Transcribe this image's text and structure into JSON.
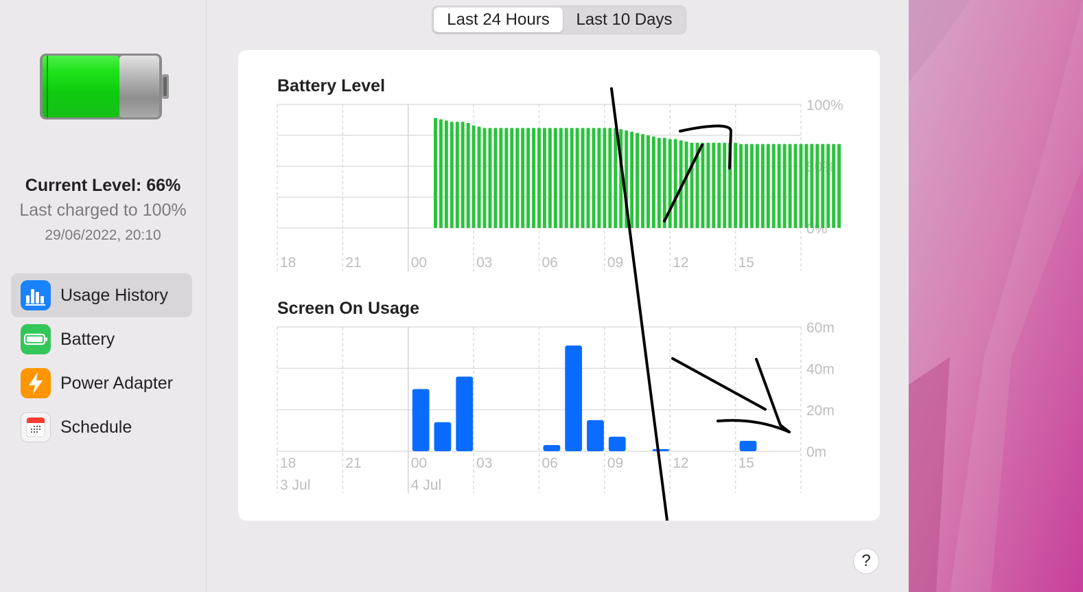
{
  "sidebar": {
    "current_level": "Current Level: 66%",
    "battery_fraction": 0.66,
    "last_charged": "Last charged to 100%",
    "charged_date": "29/06/2022, 20:10",
    "items": [
      {
        "label": "Usage History",
        "icon": "bar-chart-icon",
        "color": "#1a82fb",
        "active": true
      },
      {
        "label": "Battery",
        "icon": "battery-icon",
        "color": "#33c759",
        "active": false
      },
      {
        "label": "Power Adapter",
        "icon": "lightning-bolt-icon",
        "color": "#ff9500",
        "active": false
      },
      {
        "label": "Schedule",
        "icon": "calendar-icon",
        "color": "#ff3b30",
        "active": false
      }
    ]
  },
  "segmented": {
    "options": [
      "Last 24 Hours",
      "Last 10 Days"
    ],
    "selected": 0
  },
  "help_label": "?",
  "colors": {
    "battery_green": "#2ac33c",
    "usage_blue": "#0a6cff"
  },
  "chart_data": [
    {
      "type": "bar",
      "title": "Battery Level",
      "y_ticks": [
        "100%",
        "50%",
        "0%"
      ],
      "ylim": [
        0,
        100
      ],
      "x_ticks": [
        "18",
        "21",
        "00",
        "03",
        "06",
        "09",
        "12",
        "15"
      ],
      "x_hours": [
        18,
        21,
        24,
        27,
        30,
        33,
        36,
        39
      ],
      "bar_start_hour": 25.25,
      "bar_step_hours": 0.25,
      "values": [
        89,
        88,
        87,
        86,
        86,
        86,
        85,
        83,
        82,
        81,
        81,
        81,
        81,
        81,
        81,
        81,
        81,
        81,
        81,
        81,
        81,
        81,
        81,
        81,
        81,
        81,
        81,
        81,
        81,
        81,
        81,
        81,
        81,
        81,
        80,
        79,
        78,
        77,
        76,
        75,
        74,
        73,
        73,
        72,
        72,
        71,
        70,
        69,
        69,
        69,
        69,
        69,
        69,
        69,
        69,
        69,
        68,
        68,
        68,
        68,
        68,
        68,
        68,
        68,
        68,
        68,
        68,
        68,
        68,
        68,
        68,
        68,
        68,
        68,
        68
      ],
      "color": "#2ac33c"
    },
    {
      "type": "bar",
      "title": "Screen On Usage",
      "y_ticks": [
        "60m",
        "40m",
        "20m",
        "0m"
      ],
      "ylim": [
        0,
        60
      ],
      "x_ticks": [
        "18",
        "21",
        "00",
        "03",
        "06",
        "09",
        "12",
        "15"
      ],
      "date_labels": [
        {
          "label": "3 Jul",
          "hour": 18
        },
        {
          "label": "4 Jul",
          "hour": 24
        }
      ],
      "bars": [
        {
          "hour": 25,
          "value": 30
        },
        {
          "hour": 26,
          "value": 14
        },
        {
          "hour": 27,
          "value": 36
        },
        {
          "hour": 31,
          "value": 3
        },
        {
          "hour": 32,
          "value": 51
        },
        {
          "hour": 33,
          "value": 15
        },
        {
          "hour": 34,
          "value": 7
        },
        {
          "hour": 36,
          "value": 1
        },
        {
          "hour": 40,
          "value": 5
        }
      ],
      "color": "#0a6cff"
    }
  ]
}
